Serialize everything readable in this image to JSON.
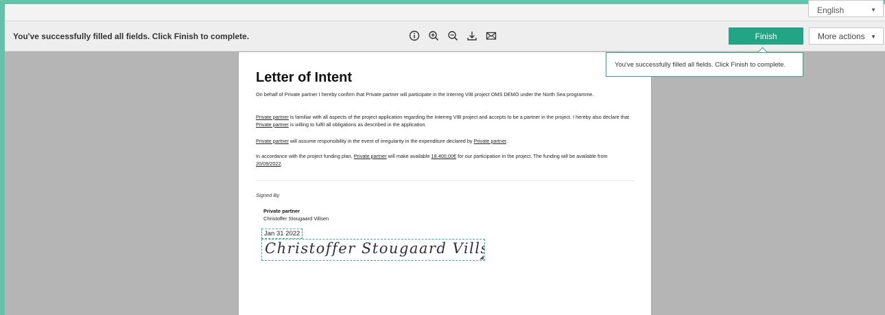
{
  "language": {
    "selected": "English"
  },
  "toolbar": {
    "status_message": "You've successfully filled all fields. Click Finish to complete.",
    "icons": [
      "info-icon",
      "zoom-in-icon",
      "zoom-out-icon",
      "download-icon",
      "email-icon"
    ],
    "finish_label": "Finish",
    "more_actions_label": "More actions"
  },
  "tooltip": {
    "text": "You've successfully filled all fields. Click Finish to complete."
  },
  "document": {
    "title": "Letter of Intent",
    "p1": "On behalf of Private partner I hereby confirm that Private partner will participate in the Interreg VIB project OMS DEMO under the North Sea programme.",
    "p2": {
      "partner": "Private partner",
      "text_a": " is familiar with all aspects of the project application regarding the Interreg VIB project and accepts to be a partner in the project. I hereby also declare that ",
      "text_b": " is willing to fulfil all obligations as described in the application."
    },
    "p3": {
      "partner": "Private partner",
      "text_a": " will assume responsibility in the event of irregularity in the expenditure declared by ",
      "end": "."
    },
    "p4": {
      "text_a": "In accordance with the project funding plan, ",
      "partner": "Private partner",
      "text_b": " will make available ",
      "amount": "18.400,00€",
      "text_c": " for our participation in the project. The funding will be available from ",
      "date": "20/09/2022",
      "end": "."
    },
    "signed_by": "Signed By",
    "signer_org": "Private partner",
    "signer_name": "Christoffer Stougaard Villsen",
    "date_value": "Jan 31 2022",
    "signature_text": "Christoffer Stougaard Villsen"
  },
  "colors": {
    "frame": "#63c3aa",
    "finish": "#22a584",
    "field_border": "#35b08f"
  }
}
